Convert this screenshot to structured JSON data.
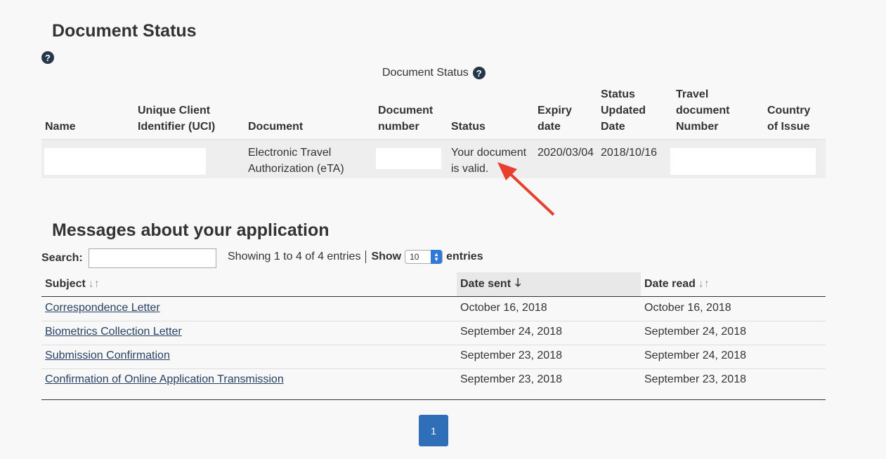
{
  "document_status": {
    "title": "Document Status",
    "caption": "Document Status",
    "headers": {
      "name": "Name",
      "uci": "Unique Client Identifier (UCI)",
      "document": "Document",
      "document_number": "Document number",
      "status": "Status",
      "expiry": "Expiry date",
      "status_updated": "Status Updated Date",
      "travel_doc_number": "Travel document Number",
      "country": "Country of Issue"
    },
    "row": {
      "document": "Electronic Travel Authorization (eTA)",
      "status": "Your document is valid.",
      "expiry": "2020/03/04",
      "status_updated": "2018/10/16"
    }
  },
  "messages": {
    "title": "Messages about your application",
    "search_label": "Search:",
    "info": "Showing 1 to 4 of 4 entries",
    "show_label": "Show",
    "show_value": "10",
    "entries_label": "entries",
    "headers": {
      "subject": "Subject",
      "date_sent": "Date sent",
      "date_read": "Date read"
    },
    "rows": [
      {
        "subject": "Correspondence Letter",
        "date_sent": "October 16, 2018",
        "date_read": "October 16, 2018"
      },
      {
        "subject": "Biometrics Collection Letter",
        "date_sent": "September 24, 2018",
        "date_read": "September 24, 2018"
      },
      {
        "subject": "Submission Confirmation",
        "date_sent": "September 23, 2018",
        "date_read": "September 24, 2018"
      },
      {
        "subject": "Confirmation of Online Application Transmission",
        "date_sent": "September 23, 2018",
        "date_read": "September 23, 2018"
      }
    ],
    "page": "1"
  },
  "colors": {
    "accent": "#2f6fb8",
    "link": "#284162",
    "annotation_arrow": "#e8402f"
  }
}
